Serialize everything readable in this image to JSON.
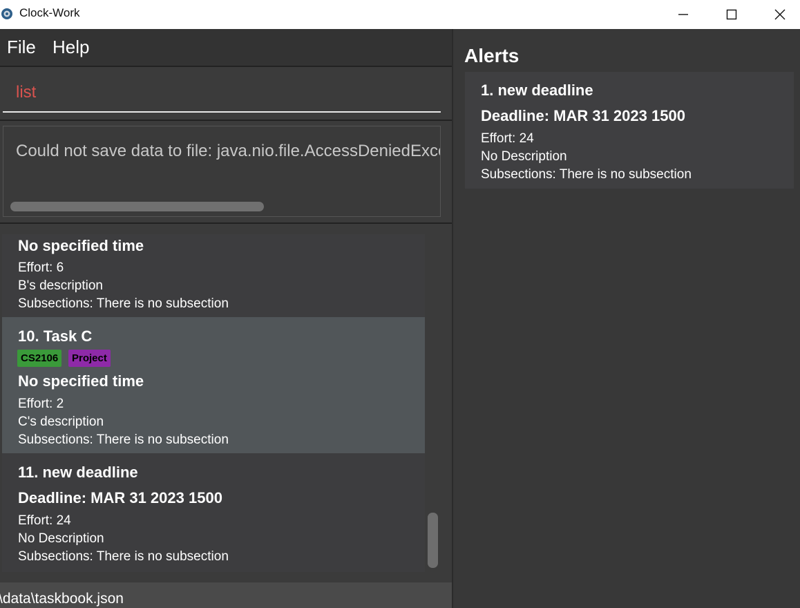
{
  "window": {
    "title": "Clock-Work"
  },
  "menu": {
    "file": "File",
    "help": "Help"
  },
  "command": {
    "value": "list"
  },
  "result": {
    "text": "Could not save data to file: java.nio.file.AccessDeniedException"
  },
  "tasks": [
    {
      "title": "",
      "tags": [],
      "time": "No specified time",
      "effort": "Effort: 6",
      "description": "B's description",
      "subsections": "Subsections: There is no subsection"
    },
    {
      "title": "10.  Task C",
      "tags": [
        {
          "label": "CS2106",
          "color": "#3a9a3a"
        },
        {
          "label": "Project",
          "color": "#8e2aa8"
        }
      ],
      "time": "No specified time",
      "effort": "Effort: 2",
      "description": "C's description",
      "subsections": "Subsections: There is no subsection"
    },
    {
      "title": "11.  new deadline",
      "tags": [],
      "time": "Deadline: MAR 31 2023 1500",
      "effort": "Effort: 24",
      "description": "No Description",
      "subsections": "Subsections: There is no subsection"
    }
  ],
  "status": {
    "path": "\\data\\taskbook.json"
  },
  "alerts": {
    "heading": "Alerts",
    "items": [
      {
        "title": "1.  new deadline",
        "time": "Deadline: MAR 31 2023 1500",
        "effort": "Effort: 24",
        "description": "No Description",
        "subsections": "Subsections: There is no subsection"
      }
    ]
  },
  "colors": {
    "card_selected": "#515659",
    "card_dark": "#3d3d3f",
    "command_text": "#d9534f"
  }
}
